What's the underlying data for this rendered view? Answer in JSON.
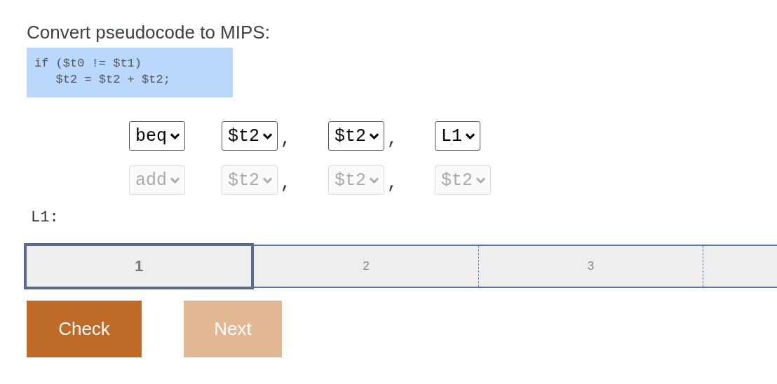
{
  "prompt": "Convert pseudocode to MIPS:",
  "code_lines": [
    "if ($t0 != $t1)",
    "   $t2 = $t2 + $t2;"
  ],
  "instructions": [
    {
      "disabled": false,
      "fields": [
        {
          "value": "beq"
        },
        {
          "value": "$t2",
          "separator": ","
        },
        {
          "value": "$t2",
          "separator": ","
        },
        {
          "value": "L1"
        }
      ]
    },
    {
      "disabled": true,
      "fields": [
        {
          "value": "add"
        },
        {
          "value": "$t2",
          "separator": ","
        },
        {
          "value": "$t2",
          "separator": ","
        },
        {
          "value": "$t2"
        }
      ]
    }
  ],
  "label": "L1:",
  "steps": [
    {
      "label": "1",
      "selected": true
    },
    {
      "label": "2",
      "selected": false
    },
    {
      "label": "3",
      "selected": false
    },
    {
      "selected": false
    }
  ],
  "buttons": [
    {
      "label": "Check",
      "disabled": false
    },
    {
      "label": "Next",
      "disabled": true
    }
  ]
}
